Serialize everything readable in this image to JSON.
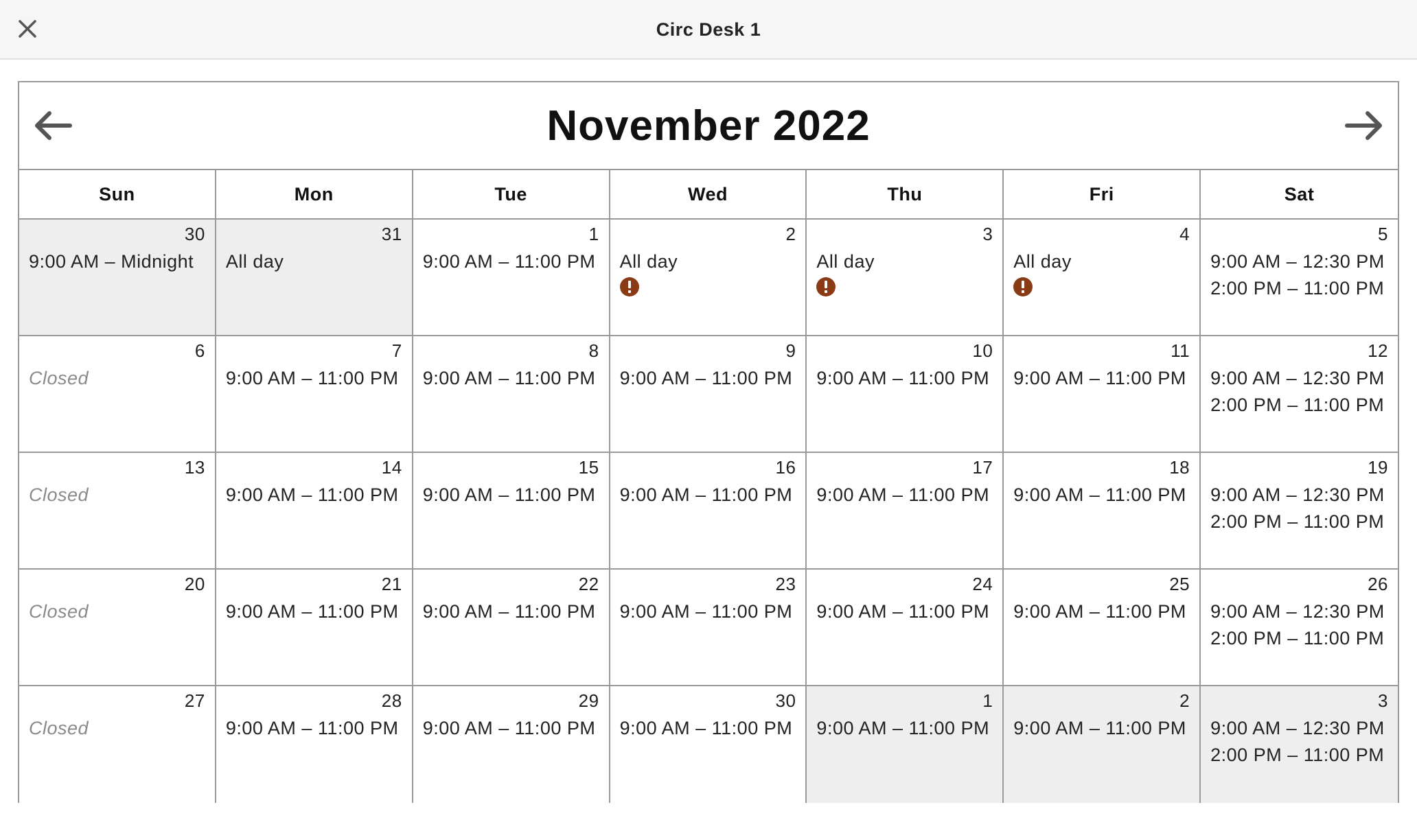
{
  "topbar": {
    "title": "Circ Desk 1",
    "close_icon": "close-icon"
  },
  "calendar": {
    "month_label": "November 2022",
    "prev_icon": "arrow-left-icon",
    "next_icon": "arrow-right-icon",
    "alert_color": "#8a3a14",
    "other_month_bg": "#eeeeee",
    "weekdays": [
      "Sun",
      "Mon",
      "Tue",
      "Wed",
      "Thu",
      "Fri",
      "Sat"
    ],
    "days": [
      {
        "num": "30",
        "other": true,
        "lines": [
          "9:00 AM – Midnight"
        ]
      },
      {
        "num": "31",
        "other": true,
        "lines": [
          "All day"
        ]
      },
      {
        "num": "1",
        "lines": [
          "9:00 AM – 11:00 PM"
        ]
      },
      {
        "num": "2",
        "lines": [
          "All day"
        ],
        "alert": true
      },
      {
        "num": "3",
        "lines": [
          "All day"
        ],
        "alert": true
      },
      {
        "num": "4",
        "lines": [
          "All day"
        ],
        "alert": true
      },
      {
        "num": "5",
        "lines": [
          "9:00 AM – 12:30 PM",
          "2:00 PM – 11:00 PM"
        ]
      },
      {
        "num": "6",
        "closed": "Closed"
      },
      {
        "num": "7",
        "lines": [
          "9:00 AM – 11:00 PM"
        ]
      },
      {
        "num": "8",
        "lines": [
          "9:00 AM – 11:00 PM"
        ]
      },
      {
        "num": "9",
        "lines": [
          "9:00 AM – 11:00 PM"
        ]
      },
      {
        "num": "10",
        "lines": [
          "9:00 AM – 11:00 PM"
        ]
      },
      {
        "num": "11",
        "lines": [
          "9:00 AM – 11:00 PM"
        ]
      },
      {
        "num": "12",
        "lines": [
          "9:00 AM – 12:30 PM",
          "2:00 PM – 11:00 PM"
        ]
      },
      {
        "num": "13",
        "closed": "Closed"
      },
      {
        "num": "14",
        "lines": [
          "9:00 AM – 11:00 PM"
        ]
      },
      {
        "num": "15",
        "lines": [
          "9:00 AM – 11:00 PM"
        ]
      },
      {
        "num": "16",
        "lines": [
          "9:00 AM – 11:00 PM"
        ]
      },
      {
        "num": "17",
        "lines": [
          "9:00 AM – 11:00 PM"
        ]
      },
      {
        "num": "18",
        "lines": [
          "9:00 AM – 11:00 PM"
        ]
      },
      {
        "num": "19",
        "lines": [
          "9:00 AM – 12:30 PM",
          "2:00 PM – 11:00 PM"
        ]
      },
      {
        "num": "20",
        "closed": "Closed"
      },
      {
        "num": "21",
        "lines": [
          "9:00 AM – 11:00 PM"
        ]
      },
      {
        "num": "22",
        "lines": [
          "9:00 AM – 11:00 PM"
        ]
      },
      {
        "num": "23",
        "lines": [
          "9:00 AM – 11:00 PM"
        ]
      },
      {
        "num": "24",
        "lines": [
          "9:00 AM – 11:00 PM"
        ]
      },
      {
        "num": "25",
        "lines": [
          "9:00 AM – 11:00 PM"
        ]
      },
      {
        "num": "26",
        "lines": [
          "9:00 AM – 12:30 PM",
          "2:00 PM – 11:00 PM"
        ]
      },
      {
        "num": "27",
        "closed": "Closed"
      },
      {
        "num": "28",
        "lines": [
          "9:00 AM – 11:00 PM"
        ]
      },
      {
        "num": "29",
        "lines": [
          "9:00 AM – 11:00 PM"
        ]
      },
      {
        "num": "30",
        "lines": [
          "9:00 AM – 11:00 PM"
        ]
      },
      {
        "num": "1",
        "other": true,
        "lines": [
          "9:00 AM – 11:00 PM"
        ]
      },
      {
        "num": "2",
        "other": true,
        "lines": [
          "9:00 AM – 11:00 PM"
        ]
      },
      {
        "num": "3",
        "other": true,
        "lines": [
          "9:00 AM – 12:30 PM",
          "2:00 PM – 11:00 PM"
        ]
      }
    ]
  }
}
